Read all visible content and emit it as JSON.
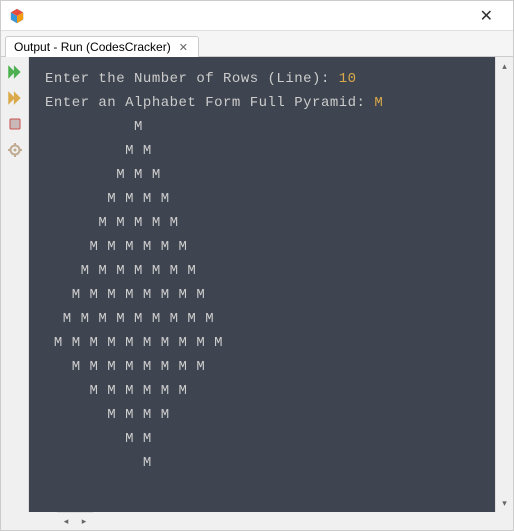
{
  "window": {
    "close_label": "✕"
  },
  "tab": {
    "label": "Output - Run (CodesCracker)",
    "close_label": "✕"
  },
  "console": {
    "prompt_rows": "Enter the Number of Rows (Line): ",
    "rows_value": "10",
    "prompt_alpha": "Enter an Alphabet Form Full Pyramid: ",
    "alpha_value": "M",
    "pyramid_lines": [
      "          M",
      "         M M",
      "        M M M",
      "       M M M M",
      "      M M M M M",
      "     M M M M M M",
      "    M M M M M M M",
      "   M M M M M M M M",
      "  M M M M M M M M M",
      " M M M M M M M M M M",
      "   M M M M M M M M",
      "     M M M M M M",
      "       M M M M",
      "         M M",
      "           M"
    ]
  },
  "icons": {
    "app_cube_colors": [
      "#e74c3c",
      "#3498db",
      "#f39c12",
      "#2ecc71"
    ],
    "run_green": "#4caf50",
    "stop_red": "#c94f4f",
    "gear_gray": "#bfa98f"
  }
}
